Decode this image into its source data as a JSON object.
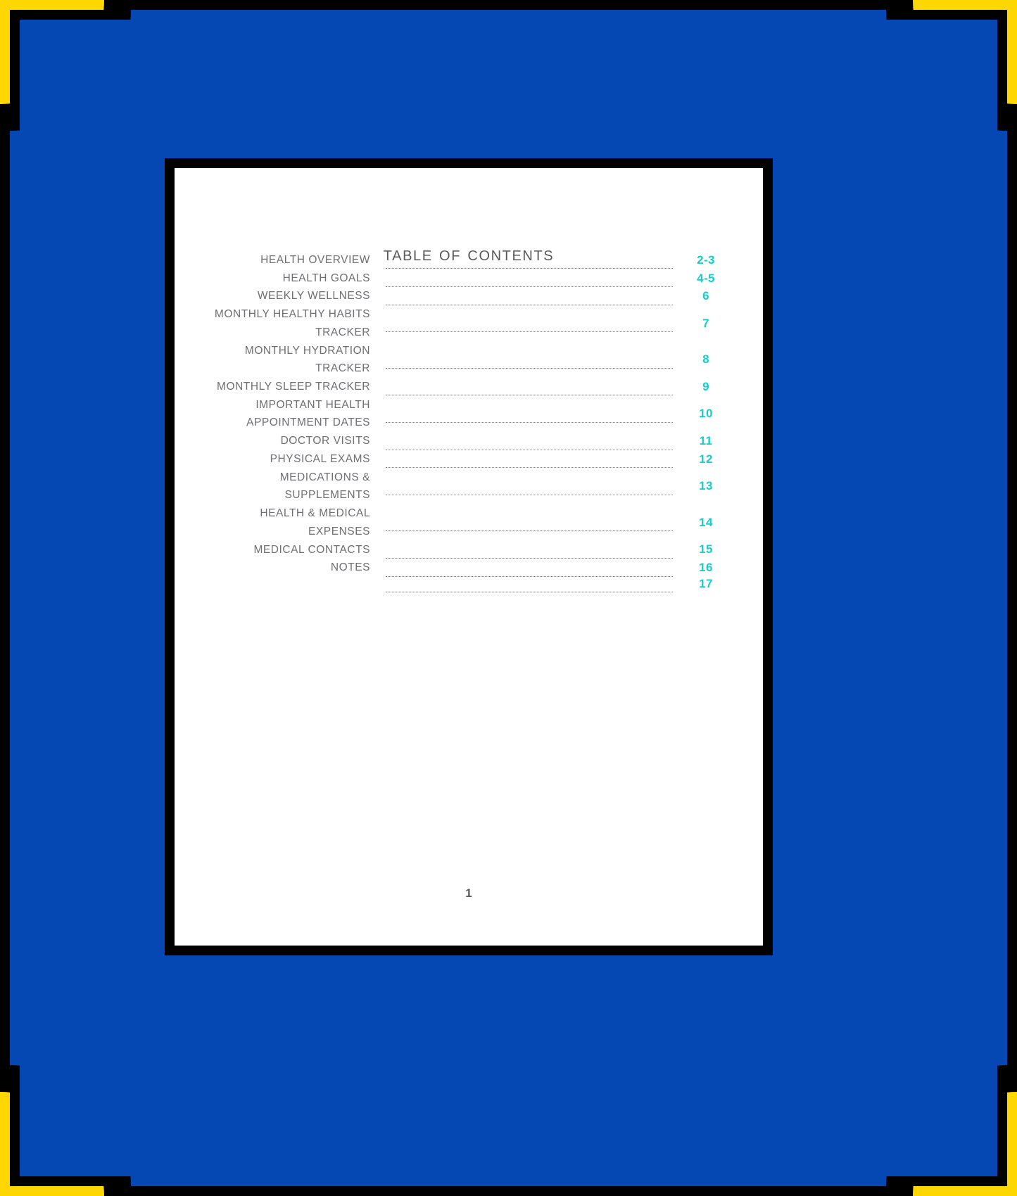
{
  "document": {
    "title": "Table of Contents",
    "title_display": "TABLE OF CONTENTS",
    "footer_page_number": "1"
  },
  "theme": {
    "background": "#000000",
    "field": "#0548B3",
    "corner_accent": "#FFD700",
    "page": "#FFFFFF",
    "label_text": "#6e6e73",
    "page_number_accent": "#12CFCB",
    "leader_line": "#7d7d7d"
  },
  "toc": {
    "entries": [
      {
        "label": "HEALTH OVERVIEW",
        "page": "2-3"
      },
      {
        "label": "HEALTH GOALS",
        "page": "4-5"
      },
      {
        "label": "WEEKLY WELLNESS",
        "page": "6"
      },
      {
        "label": "MONTHLY HEALTHY HABITS\nTRACKER",
        "page": "7"
      },
      {
        "label": "MONTHLY HYDRATION\nTRACKER",
        "page": "8"
      },
      {
        "label": "MONTHLY SLEEP TRACKER",
        "page": "9"
      },
      {
        "label": "IMPORTANT HEALTH\nAPPOINTMENT DATES",
        "page": "10"
      },
      {
        "label": "DOCTOR VISITS",
        "page": "11"
      },
      {
        "label": "PHYSICAL EXAMS",
        "page": "12"
      },
      {
        "label": "MEDICATIONS &\nSUPPLEMENTS",
        "page": "13"
      },
      {
        "label": "HEALTH & MEDICAL\nEXPENSES",
        "page": "14"
      },
      {
        "label": "MEDICAL CONTACTS",
        "page": "15"
      },
      {
        "label": "NOTES",
        "page": "16"
      },
      {
        "label": "",
        "page": "17"
      }
    ]
  }
}
